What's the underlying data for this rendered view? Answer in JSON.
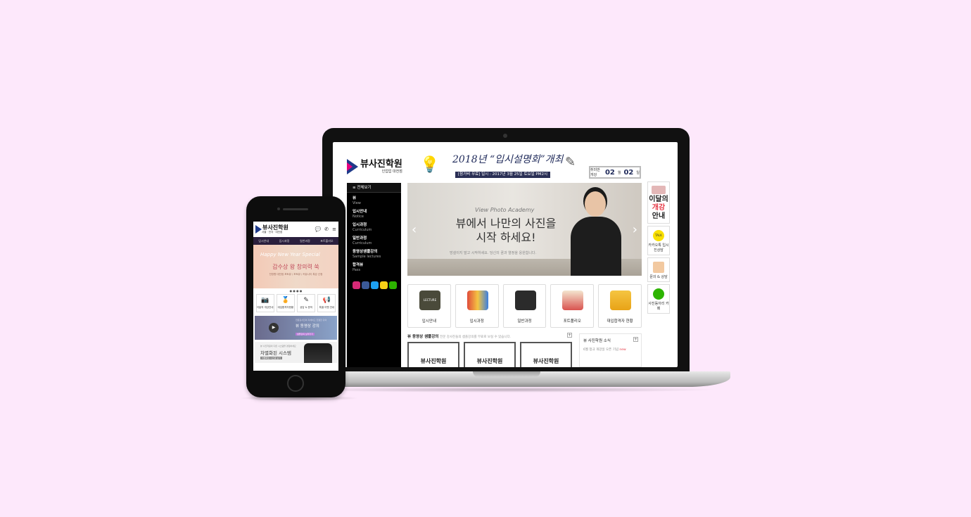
{
  "laptop": {
    "logo": {
      "main": "뷰사진학원",
      "sub": "인업업 대전점"
    },
    "banner": {
      "title": "2018년 “입시설명회”개최",
      "subtitle": "[참가비 무료]  일시 : 2017년 3월 25일 토요일 PM2시"
    },
    "countdown": {
      "label": "취미반 개강",
      "value1": "02",
      "unit1": "월",
      "value2": "02",
      "unit2": "일"
    },
    "sidebar": {
      "header": "전체보기",
      "items": [
        {
          "ko": "뷰",
          "en": "View"
        },
        {
          "ko": "입시안내",
          "en": "Notice"
        },
        {
          "ko": "입시과정",
          "en": "Curriculum"
        },
        {
          "ko": "일반과정",
          "en": "Curriculum"
        },
        {
          "ko": "동영상샘플강의",
          "en": "Sample lectures"
        },
        {
          "ko": "합격뷰",
          "en": "Pass"
        }
      ]
    },
    "hero": {
      "subtitle": "View Photo Academy",
      "title_line1": "뷰에서 나만의 사진을",
      "title_line2": "시작 하세요!",
      "desc": "망설이지 말고 시작하세요. 당신의 꿈과 열정을 응원합니다."
    },
    "rail": {
      "monthly_line1": "이달의",
      "monthly_line2": "개강",
      "monthly_line3": "안내",
      "kakao_label": "카카오톡 입시진상담",
      "kakao_badge": "TALK",
      "inquiry_label": "문의 & 상담",
      "cafe_label": "사진동아리 카페"
    },
    "categories": [
      {
        "label": "입시안내",
        "icon": "lecture-board-icon"
      },
      {
        "label": "입시과정",
        "icon": "art-tools-icon"
      },
      {
        "label": "일반과정",
        "icon": "camera-icon"
      },
      {
        "label": "포트폴리오",
        "icon": "portfolio-icon"
      },
      {
        "label": "대입합격자 현황",
        "icon": "trophy-icon"
      }
    ],
    "category_badge": "LECTURE",
    "video": {
      "title": "뷰 동영상 샘플강의",
      "desc": "전문 강사진들의 샘플강의를 무료로 보실 수 있습니다."
    },
    "thumbs": [
      "뷰사진학원",
      "뷰사진학원",
      "뷰사진학원"
    ],
    "news": {
      "title": "뷰 사진학원 소식",
      "item": "6월 정규 개강일 오픈 기념",
      "new": "new"
    }
  },
  "phone": {
    "logo": {
      "main": "뷰사진학원",
      "sub": "서울 · 전국 · 대전점"
    },
    "nav": [
      "입시안내",
      "입시과정",
      "일반과정",
      "포트폴리오"
    ],
    "hero": {
      "line1": "Happy New Year Special",
      "line2": "갑수상 왕 창의력 쑥",
      "line3": "전방향 대전점 포토뷰 / 포토뷰 / 커뮤니티 특강 신청"
    },
    "dots": "● ● ● ●",
    "icons": [
      {
        "label": "이달의 개강안내",
        "icon": "camera-icon"
      },
      {
        "label": "대입합격자현황",
        "icon": "medal-icon"
      },
      {
        "label": "상담 & 문의",
        "icon": "edit-icon"
      },
      {
        "label": "특별 이벤 안내",
        "icon": "megaphone-icon"
      }
    ],
    "video": {
      "small": "전문강사진의 자세하고 친절한 강의",
      "title": "뷰 동영상 강의",
      "button": "샘플강의 보러가기"
    },
    "system": {
      "small": "뷰 사진학원의 다른 시스템을 경험하세요",
      "title": "차별화된 시스템",
      "button": "차별화된 시스템 보기"
    }
  },
  "colors": {
    "background": "#fde8fb",
    "navy": "#1e3a8a",
    "accent_pink": "#e6007e",
    "red": "#e63946"
  }
}
